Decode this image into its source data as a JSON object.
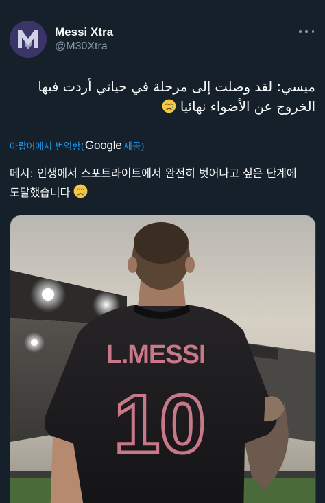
{
  "account": {
    "display_name": "Messi Xtra",
    "handle": "@M30Xtra",
    "avatar_letter": "M"
  },
  "tweet": {
    "text_line1": "ميسي: لقد وصلت إلى مرحلة في حياتي أردت فيها",
    "text_line2": "الخروج عن الأضواء نهائيا",
    "translated_prefix": "아랍어에서 번역함(",
    "translated_provider": "Google",
    "translated_suffix": " 제공)",
    "translation_line1": "메시: 인생에서 스포트라이트에서 완전히 벗어나고 싶은 단계에",
    "translation_line2": "도달했습니다",
    "emoji": "crying-face"
  },
  "image": {
    "jersey_name": "L.MESSI",
    "jersey_number": "10"
  },
  "colors": {
    "background": "#15202b",
    "link": "#1d9bf0",
    "muted": "#8b98a5",
    "jersey_print": "#c9788a"
  }
}
